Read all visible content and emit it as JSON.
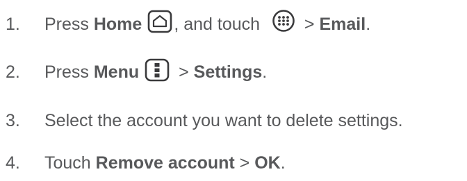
{
  "steps": [
    {
      "number": "1.",
      "press": "Press ",
      "home": "Home",
      "and_touch": ", and touch ",
      "gt": " > ",
      "email": "Email",
      "period": ".",
      "icons": [
        "home-icon",
        "apps-icon"
      ]
    },
    {
      "number": "2.",
      "press": "Press ",
      "menu": "Menu",
      "gt": " > ",
      "settings": "Settings",
      "period": ".",
      "icons": [
        "menu-icon"
      ]
    },
    {
      "number": "3.",
      "text": "Select the account you want to delete settings."
    },
    {
      "number": "4.",
      "touch": "Touch ",
      "remove": "Remove account",
      "gt": " > ",
      "ok": "OK",
      "period": "."
    }
  ],
  "colors": {
    "text": "#58595b",
    "icon": "#3a3a3c"
  }
}
